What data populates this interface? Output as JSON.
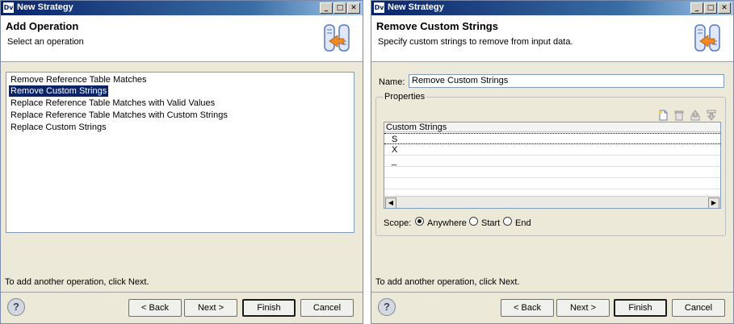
{
  "window": {
    "title": "New Strategy",
    "app_badge": "Dv",
    "minimize": "_",
    "maximize": "□",
    "close": "✕"
  },
  "left": {
    "header_title": "Add Operation",
    "header_subtitle": "Select an operation",
    "operations": [
      {
        "label": "Remove Reference Table Matches",
        "selected": false
      },
      {
        "label": "Remove Custom Strings",
        "selected": true
      },
      {
        "label": "Replace Reference Table Matches with Valid Values",
        "selected": false
      },
      {
        "label": "Replace Reference Table Matches with Custom Strings",
        "selected": false
      },
      {
        "label": "Replace Custom Strings",
        "selected": false
      }
    ],
    "hint": "To add another operation, click Next."
  },
  "right": {
    "header_title": "Remove Custom Strings",
    "header_subtitle": "Specify custom strings to remove from input data.",
    "name_label": "Name:",
    "name_value": "Remove Custom Strings",
    "properties_label": "Properties",
    "table_header": "Custom Strings",
    "rows": [
      "S",
      "X",
      "_"
    ],
    "scope_label": "Scope:",
    "scope_options": [
      "Anywhere",
      "Start",
      "End"
    ],
    "scope_selected": "Anywhere",
    "hint": "To add another operation, click Next.",
    "toolbar_icons": [
      "new-icon",
      "delete-icon",
      "move-up-icon",
      "move-down-icon"
    ]
  },
  "buttons": {
    "help": "?",
    "back": "< Back",
    "next": "Next >",
    "finish": "Finish",
    "cancel": "Cancel"
  },
  "colors": {
    "selection": "#0a246a",
    "titlebar": "#0a246a",
    "dialog_bg": "#ece9d8"
  }
}
